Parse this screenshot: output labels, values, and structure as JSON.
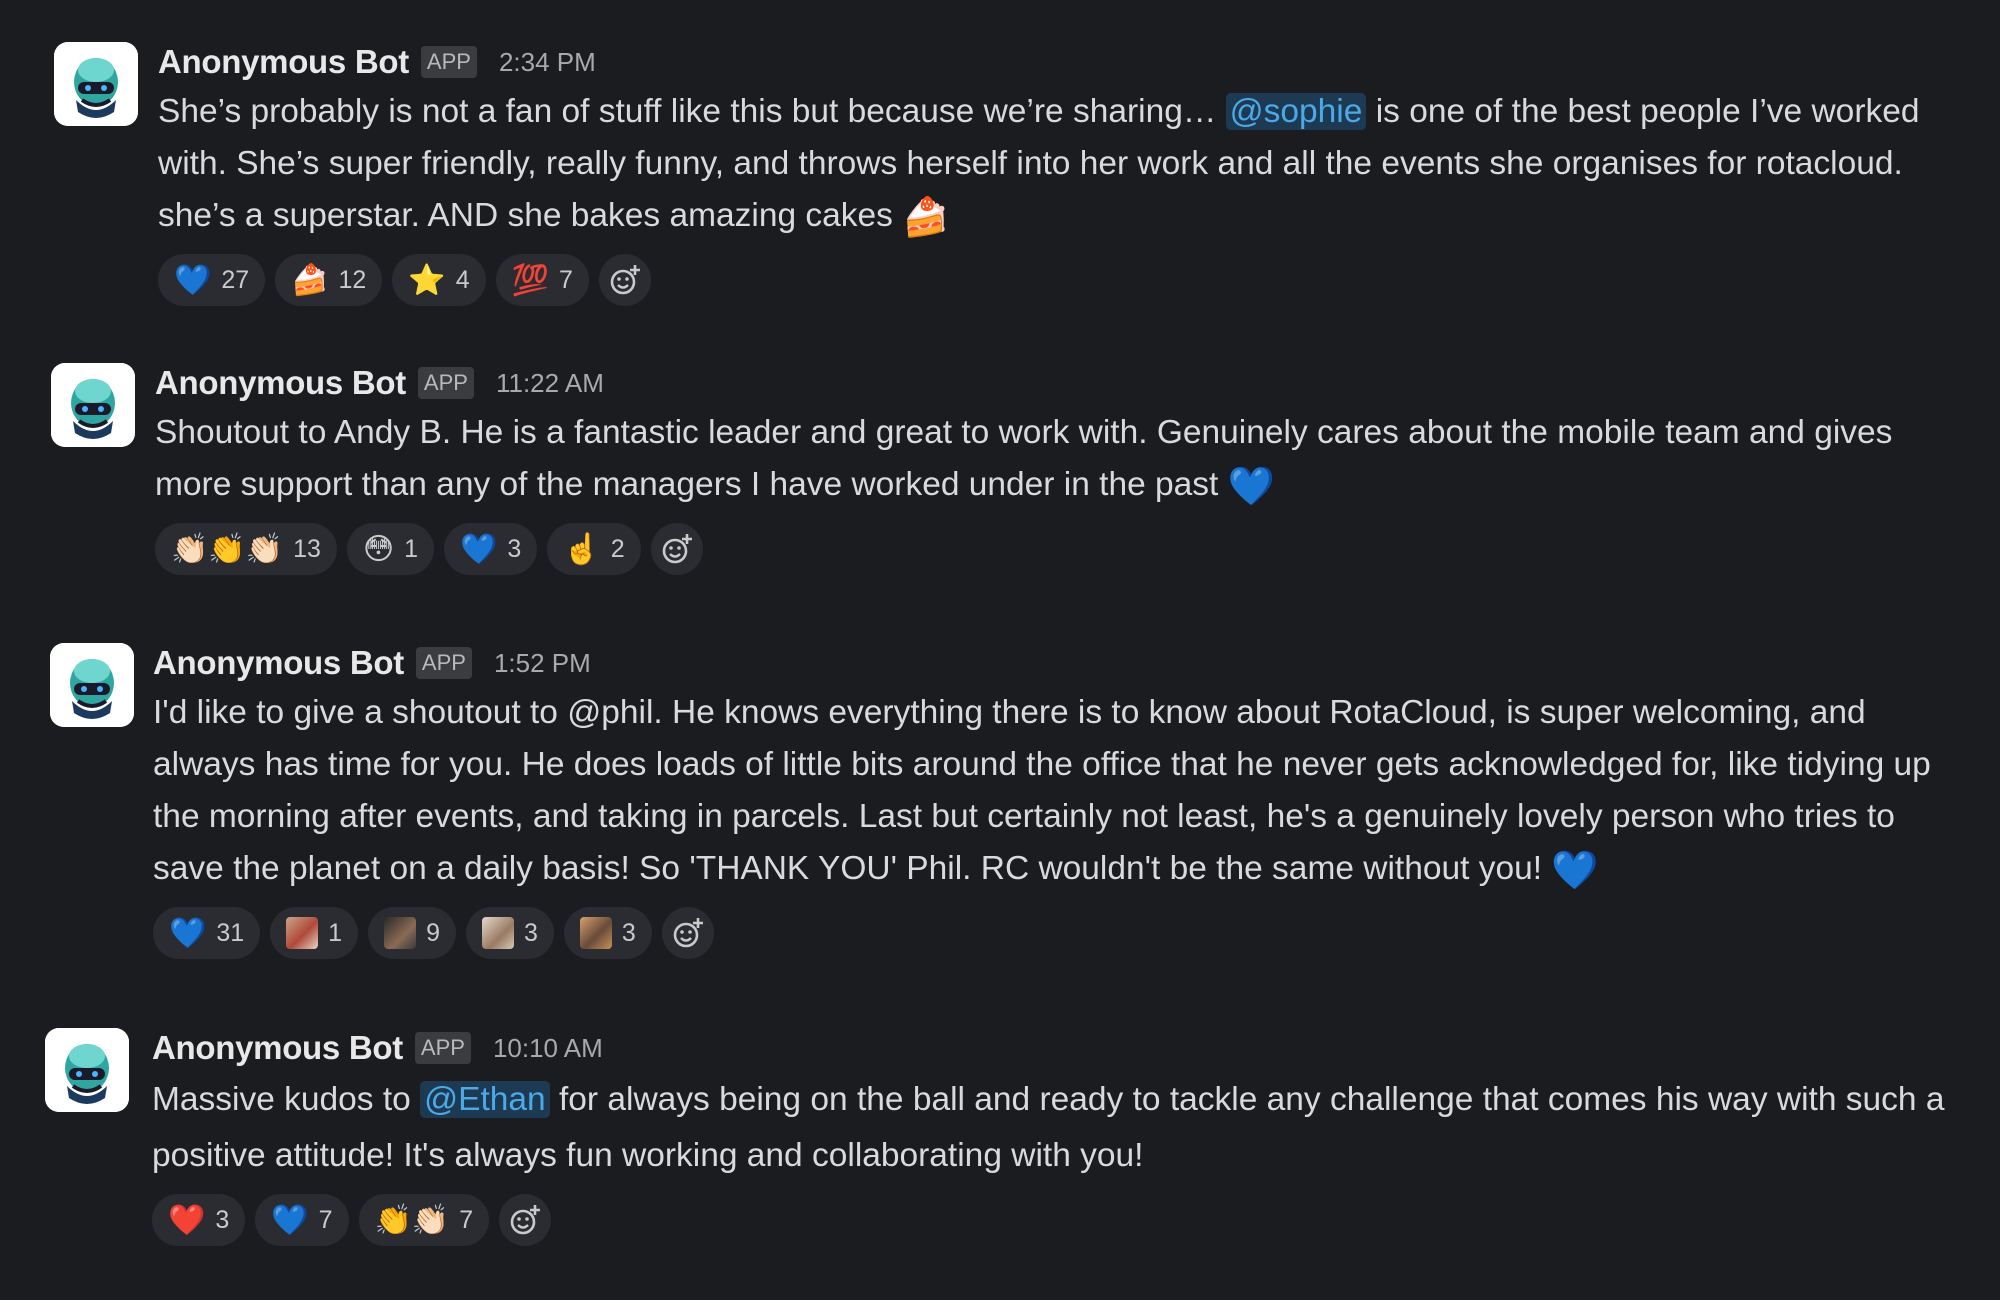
{
  "messages": [
    {
      "author": "Anonymous Bot",
      "badge": "APP",
      "time": "2:34 PM",
      "text_before": "She’s probably is not a fan of stuff like this but because we’re sharing… ",
      "mention": "@sophie",
      "text_after": " is one of the best people I’ve worked with. She’s super friendly, really funny, and throws herself into her work and all the events she organises for rotacloud. she’s a superstar. AND she bakes amazing cakes ",
      "inline_emoji": "🍰",
      "reactions": [
        {
          "emoji": "💙",
          "count": "27"
        },
        {
          "emoji": "🍰",
          "count": "12"
        },
        {
          "emoji": "⭐",
          "count": "4"
        },
        {
          "emoji": "💯",
          "count": "7"
        }
      ]
    },
    {
      "author": "Anonymous Bot",
      "badge": "APP",
      "time": "11:22 AM",
      "text_before": "Shoutout to Andy B. He is a fantastic leader and great to work with. Genuinely cares about the mobile team and gives more support than any of the managers I have worked under in the past ",
      "inline_emoji": "💙",
      "reactions": [
        {
          "emoji": "👏🏻👏👏🏻",
          "count": "13"
        },
        {
          "emoji": "😳",
          "count": "1"
        },
        {
          "emoji": "💙",
          "count": "3"
        },
        {
          "emoji": "☝️",
          "count": "2"
        }
      ]
    },
    {
      "author": "Anonymous Bot",
      "badge": "APP",
      "time": "1:52 PM",
      "text_before": "I'd like to give a shoutout to @phil. He knows everything there is to know about RotaCloud, is super welcoming, and always has time for you. He does loads of little bits around the office that he never gets acknowledged for, like tidying up the morning after events, and taking in parcels.  Last but certainly not least, he's a genuinely lovely person who tries to save the planet on a daily basis! So 'THANK YOU' Phil. RC wouldn't be the same without you! ",
      "inline_emoji": "💙",
      "reactions": [
        {
          "emoji": "💙",
          "count": "31"
        },
        {
          "emoji": "custom-1",
          "count": "1"
        },
        {
          "emoji": "custom-2",
          "count": "9"
        },
        {
          "emoji": "custom-3",
          "count": "3"
        },
        {
          "emoji": "custom-4",
          "count": "3"
        }
      ]
    },
    {
      "author": "Anonymous Bot",
      "badge": "APP",
      "time": "10:10 AM",
      "text_before": "Massive kudos to ",
      "mention": "@Ethan",
      "text_after": " for always being on the ball and ready to tackle any challenge that comes his way with such a positive attitude! It's always fun working and collaborating with you!",
      "reactions": [
        {
          "emoji": "❤️",
          "count": "3"
        },
        {
          "emoji": "💙",
          "count": "7"
        },
        {
          "emoji": "👏👏🏻",
          "count": "7"
        }
      ]
    }
  ],
  "colors": {
    "background": "#1b1c20",
    "mention_text": "#4aa9e8",
    "mention_bg": "#1d3a52",
    "reaction_bg": "#2b2c31"
  }
}
